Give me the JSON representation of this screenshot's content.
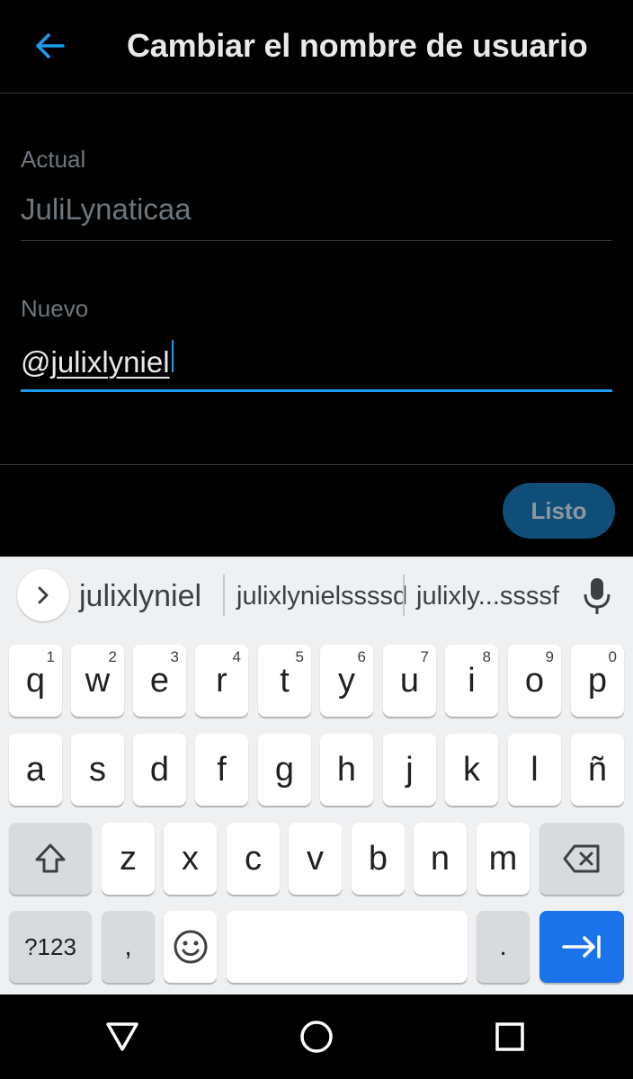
{
  "app_bar": {
    "title": "Cambiar el nombre de usuario",
    "back_icon": "arrow-left-icon"
  },
  "form": {
    "current": {
      "label": "Actual",
      "value": "JuliLynaticaa"
    },
    "new": {
      "label": "Nuevo",
      "prefix": "@",
      "value": "julixlyniel"
    }
  },
  "done_button": {
    "label": "Listo"
  },
  "keyboard": {
    "suggestions": [
      "julixlyniel",
      "julixlynielssssd",
      "julixly...ssssf"
    ],
    "row1": [
      {
        "ch": "q",
        "hint": "1"
      },
      {
        "ch": "w",
        "hint": "2"
      },
      {
        "ch": "e",
        "hint": "3"
      },
      {
        "ch": "r",
        "hint": "4"
      },
      {
        "ch": "t",
        "hint": "5"
      },
      {
        "ch": "y",
        "hint": "6"
      },
      {
        "ch": "u",
        "hint": "7"
      },
      {
        "ch": "i",
        "hint": "8"
      },
      {
        "ch": "o",
        "hint": "9"
      },
      {
        "ch": "p",
        "hint": "0"
      }
    ],
    "row2": [
      "a",
      "s",
      "d",
      "f",
      "g",
      "h",
      "j",
      "k",
      "l",
      "ñ"
    ],
    "row3": [
      "z",
      "x",
      "c",
      "v",
      "b",
      "n",
      "m"
    ],
    "symbols_label": "?123",
    "comma": ",",
    "period": "."
  },
  "colors": {
    "accent": "#1d9bf0",
    "done_bg": "#0f4e78",
    "enter_key": "#1a73e8"
  }
}
